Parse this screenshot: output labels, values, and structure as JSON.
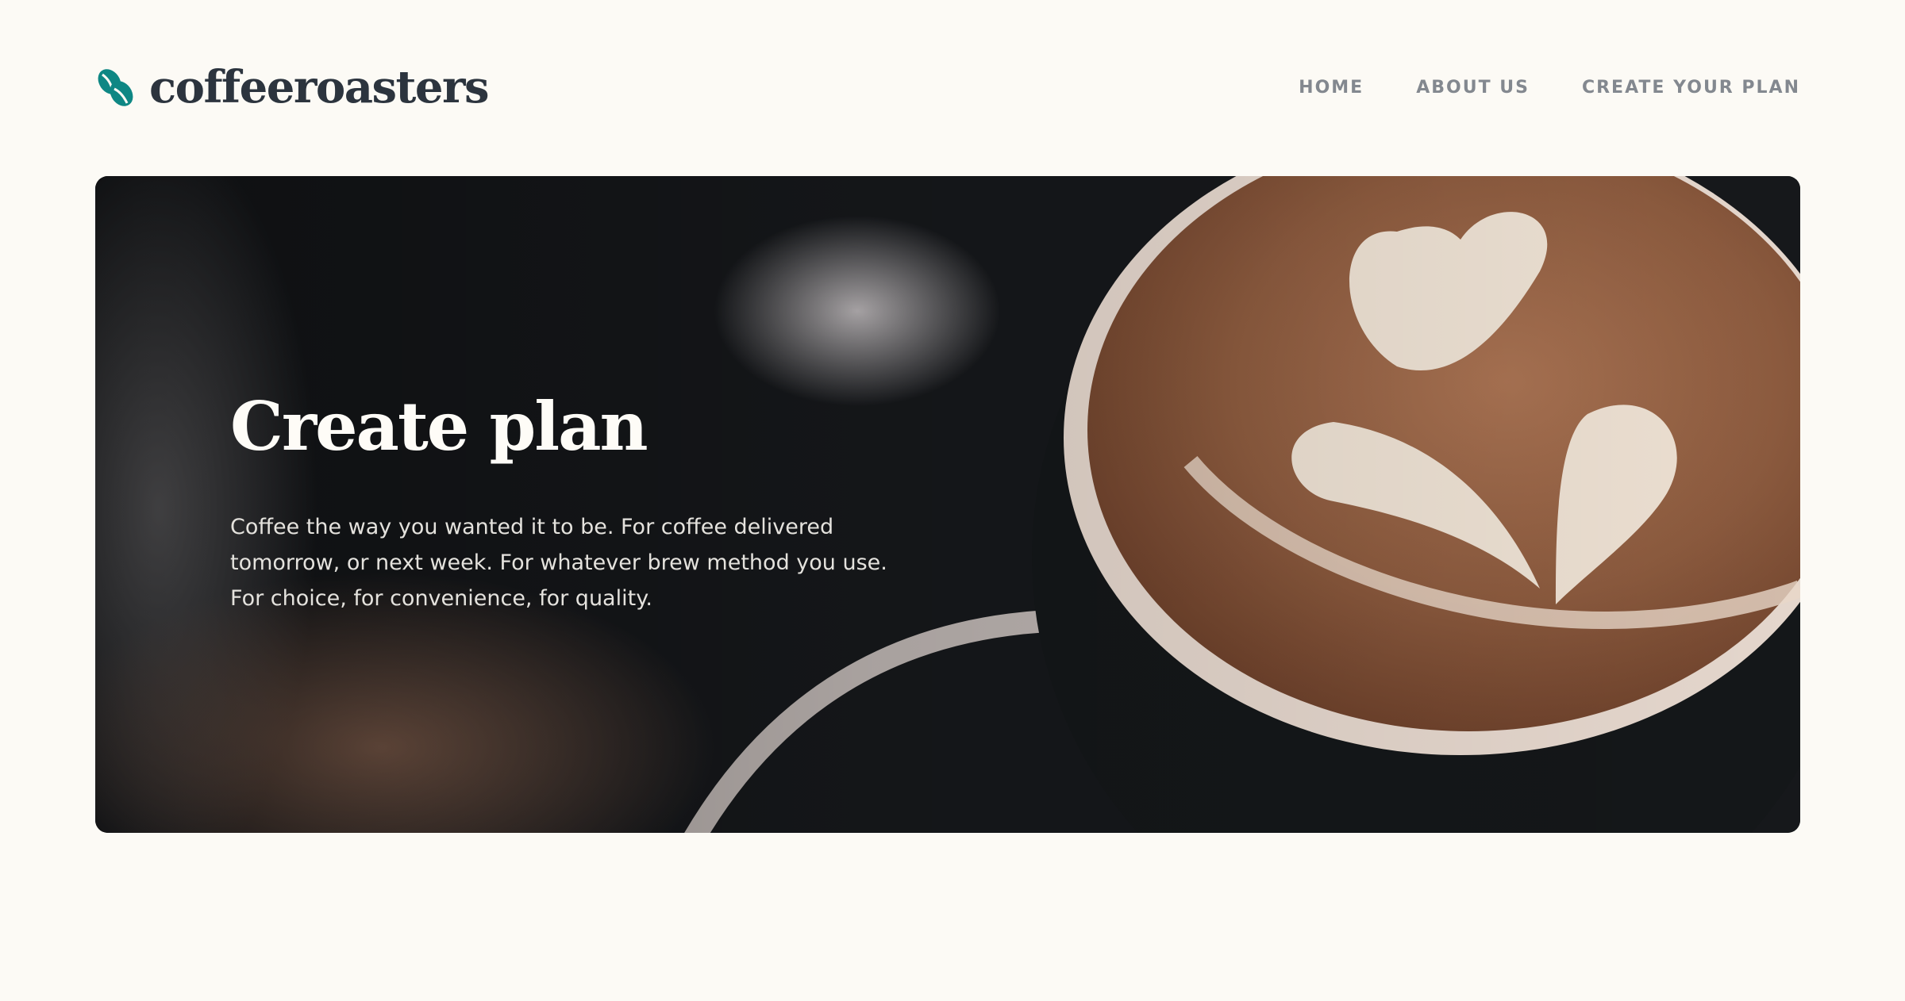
{
  "brand": {
    "name": "coffeeroasters",
    "icon": "coffee-bean-icon",
    "accent": "#0e8784"
  },
  "nav": {
    "items": [
      {
        "label": "HOME"
      },
      {
        "label": "ABOUT US"
      },
      {
        "label": "CREATE YOUR PLAN"
      }
    ]
  },
  "hero": {
    "title": "Create plan",
    "description": "Coffee the way you wanted it to be. For coffee delivered tomorrow, or next week. For whatever brew method you use. For choice, for convenience, for quality.",
    "image": "latte-art-cup"
  },
  "colors": {
    "background": "#fcfaf5",
    "text_dark": "#333d4b",
    "nav_text": "#83888f"
  }
}
